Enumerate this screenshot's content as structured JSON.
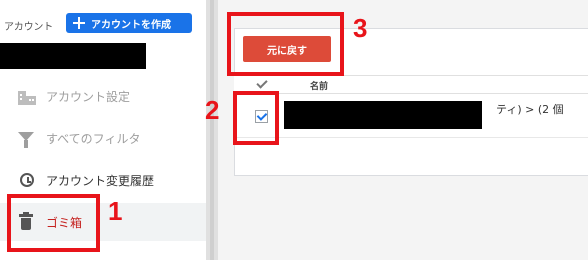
{
  "sidebar": {
    "account_label": "アカウント",
    "create_account_button": "アカウントを作成",
    "items": [
      {
        "label": "アカウント設定",
        "icon": "building-icon",
        "state": "disabled"
      },
      {
        "label": "すべてのフィルタ",
        "icon": "filter-icon",
        "state": "disabled"
      },
      {
        "label": "アカウント変更履歴",
        "icon": "history-icon",
        "state": "normal"
      },
      {
        "label": "ゴミ箱",
        "icon": "trash-icon",
        "state": "active"
      }
    ]
  },
  "main": {
    "restore_button": "元に戻す",
    "table": {
      "columns": [
        "名前"
      ],
      "rows": [
        {
          "checked": true,
          "name_visible_tail": "ティ) > (2 個",
          "name_line2_visible": "",
          "partially_redacted": true
        }
      ]
    }
  },
  "annotations": [
    {
      "number": "1",
      "target": "trash-nav-item"
    },
    {
      "number": "2",
      "target": "row-checkbox"
    },
    {
      "number": "3",
      "target": "restore-button"
    }
  ],
  "colors": {
    "primary": "#1a73e8",
    "danger": "#dd4b39",
    "annotation": "#e8141a",
    "active_nav_text": "#c5221f"
  }
}
